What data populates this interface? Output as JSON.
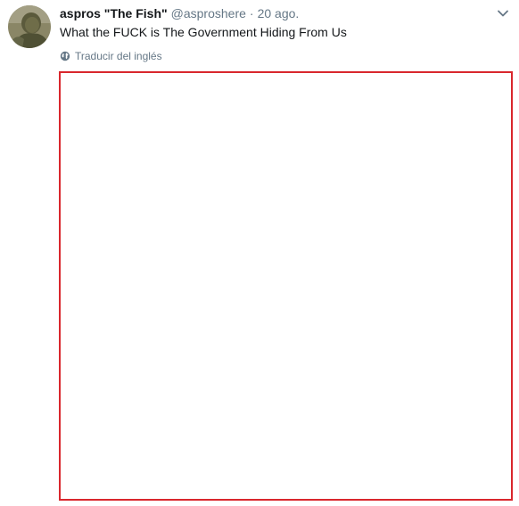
{
  "tweet": {
    "display_name": "aspros \"The Fish\"",
    "username": "@asproshere",
    "separator": "·",
    "timestamp": "20 ago.",
    "text": "What the FUCK is The Government Hiding From Us",
    "translate_label": "Traducir del inglés",
    "avatar_icon": "user-avatar-icon",
    "caret_icon": "chevron-down-icon",
    "translate_icon": "globe-icon"
  },
  "colors": {
    "primary_text": "#14171a",
    "secondary_text": "#657786",
    "media_border": "#d9272d",
    "background": "#ffffff"
  }
}
